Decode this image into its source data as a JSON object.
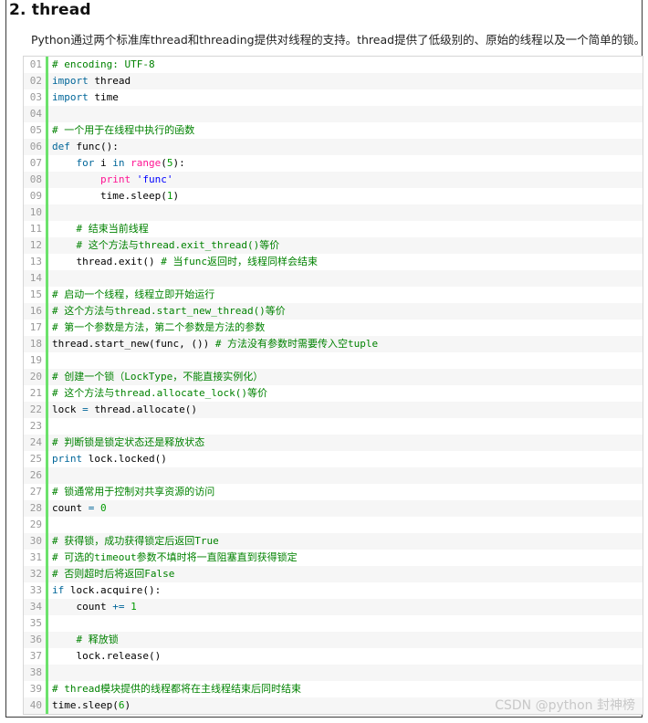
{
  "heading": "2. thread",
  "intro": "Python通过两个标准库thread和threading提供对线程的支持。thread提供了低级别的、原始的线程以及一个简单的锁。",
  "code_lines": [
    {
      "n": "01",
      "t": [
        [
          "cm",
          "# encoding: UTF-8"
        ]
      ]
    },
    {
      "n": "02",
      "t": [
        [
          "kw",
          "import"
        ],
        [
          "",
          " thread"
        ]
      ]
    },
    {
      "n": "03",
      "t": [
        [
          "kw",
          "import"
        ],
        [
          "",
          " time"
        ]
      ]
    },
    {
      "n": "04",
      "t": []
    },
    {
      "n": "05",
      "t": [
        [
          "cm",
          "# 一个用于在线程中执行的函数"
        ]
      ]
    },
    {
      "n": "06",
      "t": [
        [
          "kw",
          "def"
        ],
        [
          "",
          " func():"
        ]
      ]
    },
    {
      "n": "07",
      "t": [
        [
          "",
          "    "
        ],
        [
          "kw",
          "for"
        ],
        [
          "",
          " i "
        ],
        [
          "kw",
          "in"
        ],
        [
          "",
          " "
        ],
        [
          "bi",
          "range"
        ],
        [
          "",
          "("
        ],
        [
          "nb",
          "5"
        ],
        [
          "",
          "):"
        ]
      ]
    },
    {
      "n": "08",
      "t": [
        [
          "",
          "        "
        ],
        [
          "bi",
          "print"
        ],
        [
          "",
          " "
        ],
        [
          "st",
          "'func'"
        ]
      ]
    },
    {
      "n": "09",
      "t": [
        [
          "",
          "        time.sleep("
        ],
        [
          "nb",
          "1"
        ],
        [
          "",
          ")"
        ]
      ]
    },
    {
      "n": "10",
      "t": []
    },
    {
      "n": "11",
      "t": [
        [
          "",
          "    "
        ],
        [
          "cm",
          "# 结束当前线程"
        ]
      ]
    },
    {
      "n": "12",
      "t": [
        [
          "",
          "    "
        ],
        [
          "cm",
          "# 这个方法与thread.exit_thread()等价"
        ]
      ]
    },
    {
      "n": "13",
      "t": [
        [
          "",
          "    thread.exit() "
        ],
        [
          "cm",
          "# 当func返回时，线程同样会结束"
        ]
      ]
    },
    {
      "n": "14",
      "t": []
    },
    {
      "n": "15",
      "t": [
        [
          "cm",
          "# 启动一个线程，线程立即开始运行"
        ]
      ]
    },
    {
      "n": "16",
      "t": [
        [
          "cm",
          "# 这个方法与thread.start_new_thread()等价"
        ]
      ]
    },
    {
      "n": "17",
      "t": [
        [
          "cm",
          "# 第一个参数是方法，第二个参数是方法的参数"
        ]
      ]
    },
    {
      "n": "18",
      "t": [
        [
          "",
          "thread.start_new(func, ()) "
        ],
        [
          "cm",
          "# 方法没有参数时需要传入空tuple"
        ]
      ]
    },
    {
      "n": "19",
      "t": []
    },
    {
      "n": "20",
      "t": [
        [
          "cm",
          "# 创建一个锁（LockType，不能直接实例化）"
        ]
      ]
    },
    {
      "n": "21",
      "t": [
        [
          "cm",
          "# 这个方法与thread.allocate_lock()等价"
        ]
      ]
    },
    {
      "n": "22",
      "t": [
        [
          "",
          "lock "
        ],
        [
          "kw",
          "="
        ],
        [
          "",
          " thread.allocate()"
        ]
      ]
    },
    {
      "n": "23",
      "t": []
    },
    {
      "n": "24",
      "t": [
        [
          "cm",
          "# 判断锁是锁定状态还是释放状态"
        ]
      ]
    },
    {
      "n": "25",
      "t": [
        [
          "kw",
          "print"
        ],
        [
          "",
          " lock.locked()"
        ]
      ]
    },
    {
      "n": "26",
      "t": []
    },
    {
      "n": "27",
      "t": [
        [
          "cm",
          "# 锁通常用于控制对共享资源的访问"
        ]
      ]
    },
    {
      "n": "28",
      "t": [
        [
          "",
          "count "
        ],
        [
          "kw",
          "="
        ],
        [
          "",
          " "
        ],
        [
          "nb",
          "0"
        ]
      ]
    },
    {
      "n": "29",
      "t": []
    },
    {
      "n": "30",
      "t": [
        [
          "cm",
          "# 获得锁，成功获得锁定后返回True"
        ]
      ]
    },
    {
      "n": "31",
      "t": [
        [
          "cm",
          "# 可选的timeout参数不填时将一直阻塞直到获得锁定"
        ]
      ]
    },
    {
      "n": "32",
      "t": [
        [
          "cm",
          "# 否则超时后将返回False"
        ]
      ]
    },
    {
      "n": "33",
      "t": [
        [
          "kw",
          "if"
        ],
        [
          "",
          " lock.acquire():"
        ]
      ]
    },
    {
      "n": "34",
      "t": [
        [
          "",
          "    count "
        ],
        [
          "kw",
          "+="
        ],
        [
          "",
          " "
        ],
        [
          "nb",
          "1"
        ]
      ]
    },
    {
      "n": "35",
      "t": []
    },
    {
      "n": "36",
      "t": [
        [
          "",
          "    "
        ],
        [
          "cm",
          "# 释放锁"
        ]
      ]
    },
    {
      "n": "37",
      "t": [
        [
          "",
          "    lock.release()"
        ]
      ]
    },
    {
      "n": "38",
      "t": []
    },
    {
      "n": "39",
      "t": [
        [
          "cm",
          "# thread模块提供的线程都将在主线程结束后同时结束"
        ]
      ]
    },
    {
      "n": "40",
      "t": [
        [
          "",
          "time.sleep("
        ],
        [
          "nb",
          "6"
        ],
        [
          "",
          ")"
        ]
      ]
    }
  ],
  "watermark": "CSDN @python 封神榜",
  "colors": {
    "comment": "#008200",
    "keyword": "#006699",
    "builtin": "#ff1493",
    "string": "#0000ff",
    "number": "#009900",
    "gutter_bar": "#6ce26c"
  }
}
